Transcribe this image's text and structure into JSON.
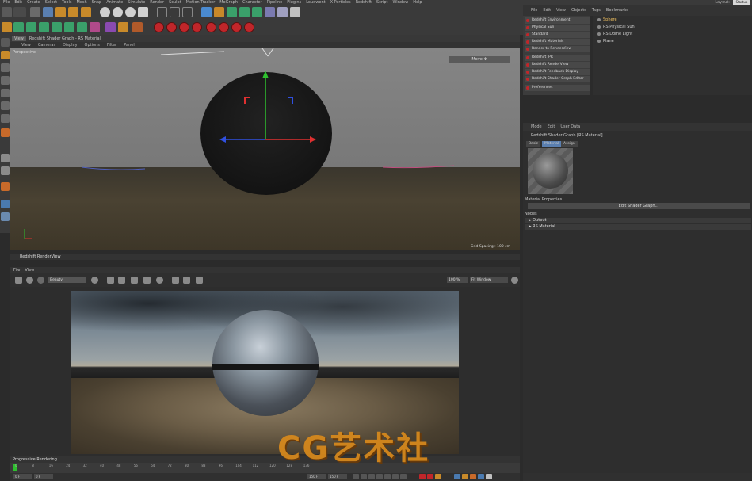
{
  "menubar": {
    "items": [
      "File",
      "Edit",
      "Create",
      "Select",
      "Tools",
      "Mesh",
      "Snap",
      "Animate",
      "Simulate",
      "Render",
      "Sculpt",
      "Motion Tracker",
      "MoGraph",
      "Character",
      "Pipeline",
      "Plugins",
      "Loudwent",
      "X-Particles",
      "Redshift",
      "Script",
      "Window",
      "Help"
    ],
    "layout_label": "Layout:",
    "layout_value": "Startup"
  },
  "viewport": {
    "tab": "View",
    "title": "Redshift Shader Graph - RS Material",
    "menus": [
      "View",
      "Cameras",
      "Display",
      "Options",
      "Filter",
      "Panel"
    ],
    "camera_label": "Perspective",
    "mode_label": "Move ✥",
    "grid_spacing": "Grid Spacing : 100 cm"
  },
  "object_manager": {
    "menus": [
      "File",
      "Edit",
      "View",
      "Objects",
      "Tags",
      "Bookmarks"
    ],
    "redshift_menu": [
      "Redshift Environment",
      "Physical Sun",
      "Standard",
      "Redshift Materials",
      "Render to RenderView",
      "Redshift IPR",
      "Redshift RenderView",
      "Redshift Feedback Display",
      "Redshift Shader Graph Editor",
      "Preferences"
    ],
    "objects": [
      {
        "name": "Sphere",
        "selected": true
      },
      {
        "name": "RS Physical Sun",
        "selected": false
      },
      {
        "name": "RS Dome Light",
        "selected": false
      },
      {
        "name": "Plane",
        "selected": false
      }
    ]
  },
  "attributes": {
    "menus": [
      "Mode",
      "Edit",
      "User Data"
    ],
    "title": "Redshift Shader Graph [RS Material]",
    "tabs": [
      "Basic",
      "Material",
      "Assign"
    ],
    "active_tab": "Material",
    "material_properties": "Material Properties",
    "edit_button": "Edit Shader Graph...",
    "nodes_label": "Nodes",
    "nodes": [
      "▸ Output",
      "▸ RS Material"
    ]
  },
  "renderview": {
    "title": "Redshift RenderView",
    "menus": [
      "File",
      "View"
    ],
    "mode_select": "Beauty",
    "zoom": "100 %",
    "window_select": "Fit Window",
    "status": "Progressive Rendering..."
  },
  "timeline": {
    "ticks": [
      "0",
      "8",
      "16",
      "24",
      "32",
      "40",
      "48",
      "56",
      "64",
      "72",
      "80",
      "88",
      "96",
      "104",
      "112",
      "120",
      "128",
      "136"
    ]
  },
  "playbar": {
    "start_field": "0 F",
    "current_field": "0 F",
    "end_field": "150 F",
    "end_field2": "150 F"
  },
  "watermark": {
    "text": "CG艺术社"
  },
  "colors": {
    "accent_red": "#c0262a",
    "selected_object": "#f0c060",
    "watermark": "#d98a1c"
  }
}
